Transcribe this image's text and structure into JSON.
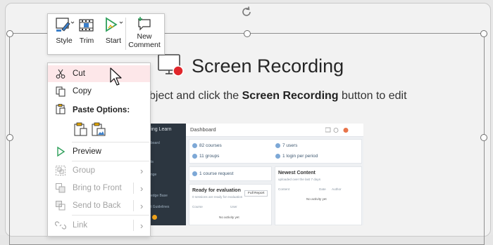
{
  "slide": {
    "title": "Screen Recording",
    "subtitle_pre": "bject and click the ",
    "subtitle_bold": "Screen Recording",
    "subtitle_post": " button to edit"
  },
  "mini_toolbar": {
    "buttons": [
      {
        "label": "Style",
        "icon": "style-icon"
      },
      {
        "label": "Trim",
        "icon": "trim-icon"
      },
      {
        "label": "Start",
        "icon": "start-icon"
      },
      {
        "label": "New Comment",
        "label_line1": "New",
        "label_line2": "Comment",
        "icon": "new-comment-icon"
      }
    ]
  },
  "context_menu": {
    "items": [
      {
        "label": "Cut",
        "icon": "scissors-icon",
        "enabled": true,
        "highlighted": true
      },
      {
        "label": "Copy",
        "icon": "copy-icon",
        "enabled": true
      },
      {
        "label": "Paste Options:",
        "icon": "paste-icon",
        "enabled": true
      },
      {
        "label": "Preview",
        "icon": "play-icon",
        "enabled": true
      },
      {
        "label": "Group",
        "icon": "group-icon",
        "enabled": false,
        "submenu": true
      },
      {
        "label": "Bring to Front",
        "icon": "bring-front-icon",
        "enabled": false,
        "submenu": true
      },
      {
        "label": "Send to Back",
        "icon": "send-back-icon",
        "enabled": false,
        "submenu": true
      },
      {
        "label": "Link",
        "icon": "link-icon",
        "enabled": false,
        "submenu": true
      }
    ],
    "paste_options": [
      "paste-keep-source-icon",
      "paste-picture-icon"
    ]
  },
  "thumbnail": {
    "brand": "ring Learn",
    "sidebar_items": [
      "board",
      "",
      "ts",
      "nge",
      "",
      "",
      "edge Base",
      "t Guidelines"
    ],
    "topbar_title": "Dashboard",
    "stats": {
      "courses": "82 courses",
      "groups": "11 groups",
      "users": "7 users",
      "login": "1 login per period"
    },
    "course_request": "1 course request",
    "ready_title": "Ready for evaluation",
    "ready_sub": "0 sessions are ready for evaluation",
    "full_report": "Full Report",
    "ready_cols": [
      "Course",
      "User"
    ],
    "ready_empty": "No activity yet",
    "newest_title": "Newest Content",
    "newest_sub": "uploaded over the last 7 days",
    "newest_cols": [
      "Content",
      "Date",
      "Author"
    ],
    "newest_empty": "No activity yet"
  },
  "colors": {
    "highlight": "#fde7e9",
    "accent_green": "#2e9f5a",
    "record_red": "#e0262b",
    "thumb_sidebar": "#2c3640"
  }
}
